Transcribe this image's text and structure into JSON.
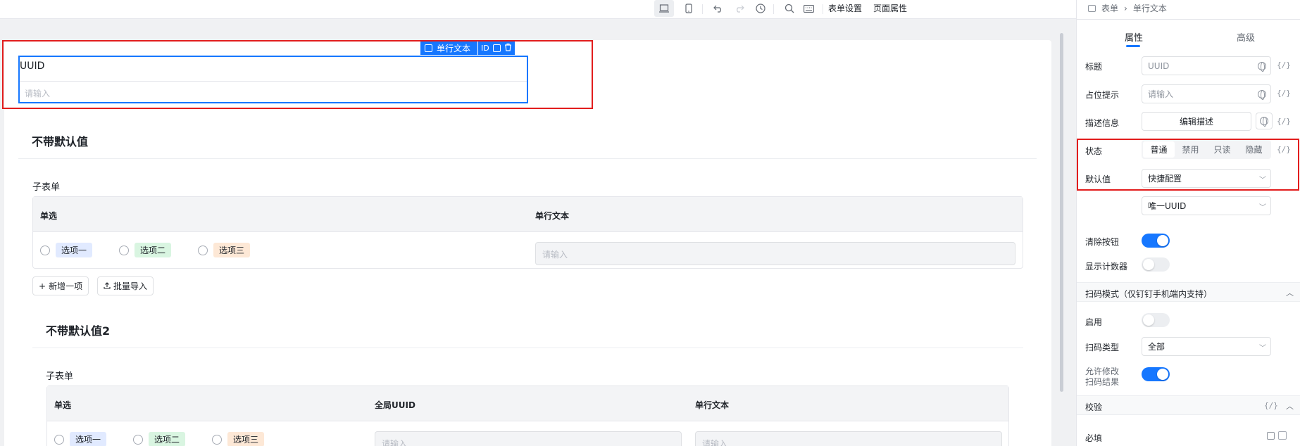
{
  "toolbar": {
    "form_settings": "表单设置",
    "page_props": "页面属性"
  },
  "selected_field": {
    "component_name": "单行文本",
    "id_label": "ID",
    "label": "UUID",
    "placeholder": "请输入"
  },
  "section1": {
    "title": "不带默认值",
    "subform_label": "子表单",
    "columns": [
      "单选",
      "单行文本"
    ],
    "options": [
      "选项一",
      "选项二",
      "选项三"
    ],
    "input_placeholder": "请输入",
    "add_button": "新增一项",
    "import_button": "批量导入"
  },
  "section2": {
    "title": "不带默认值2",
    "subform_label": "子表单",
    "columns": [
      "单选",
      "全局UUID",
      "单行文本"
    ],
    "options": [
      "选项一",
      "选项二",
      "选项三"
    ],
    "input_placeholder": "请输入"
  },
  "panel": {
    "breadcrumb": [
      "表单",
      "单行文本"
    ],
    "tabs": [
      "属性",
      "高级"
    ],
    "fx": "{/}",
    "title_label": "标题",
    "title_value": "UUID",
    "placeholder_label": "占位提示",
    "placeholder_value": "请输入",
    "desc_label": "描述信息",
    "desc_button": "编辑描述",
    "status_label": "状态",
    "status_options": [
      "普通",
      "禁用",
      "只读",
      "隐藏"
    ],
    "default_label": "默认值",
    "default_mode": "快捷配置",
    "default_value": "唯一UUID",
    "clear_label": "清除按钮",
    "counter_label": "显示计数器",
    "scan_group": "扫码模式（仅钉钉手机端内支持）",
    "enable_label": "启用",
    "scan_type_label": "扫码类型",
    "scan_type_value": "全部",
    "allow_edit_label_1": "允许修改",
    "allow_edit_label_2": "扫码结果",
    "validate_group": "校验",
    "required_label": "必填"
  },
  "toggles": {
    "clear": true,
    "counter": false,
    "scan_enable": false,
    "allow_edit": true
  },
  "colors": {
    "accent": "#1677ff",
    "highlight": "#e21d1d"
  }
}
